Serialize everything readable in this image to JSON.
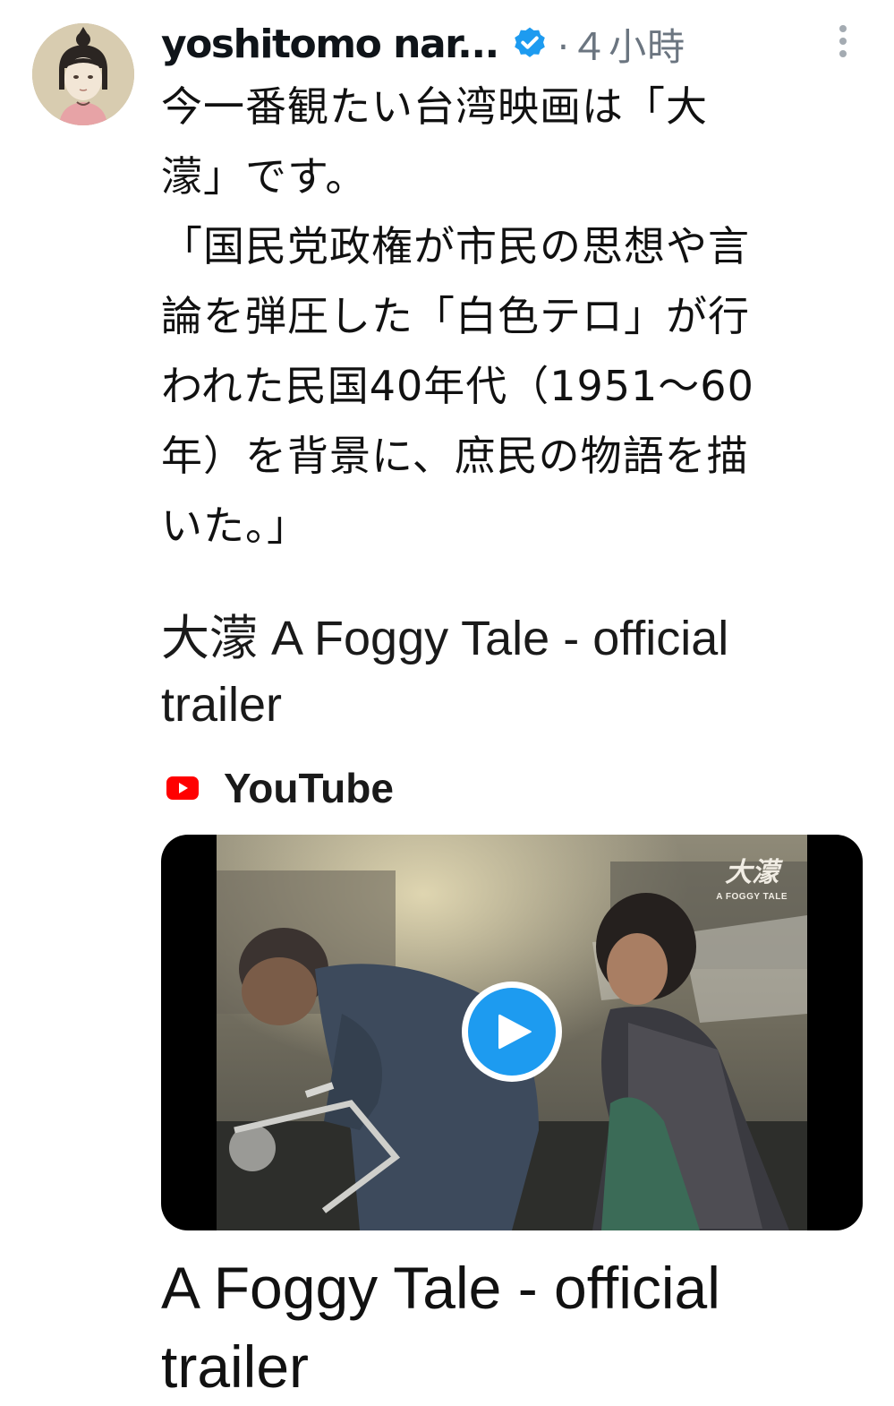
{
  "post": {
    "author_name": "yoshitomo nar...",
    "time": "·４小時",
    "text_lines": [
      "今一番観たい台湾映画は「大",
      "濛」です。",
      "「国民党政権が市民の思想や言",
      "論を弾圧した「白色テロ」が行",
      "われた民国40年代（1951〜60",
      "年）を背景に、庶民の物語を描",
      "いた。」"
    ]
  },
  "link_card": {
    "title_lines": [
      "大濛  A Foggy Tale - official",
      "trailer"
    ],
    "source": "YouTube",
    "thumbnail_logo_title": "大濛",
    "thumbnail_logo_sub": "A FOGGY TALE",
    "video_title_lines": [
      "A Foggy Tale - official",
      "trailer"
    ]
  },
  "icons": {
    "avatar": "avatar-illustrated-girl",
    "verified": "verified-badge-icon",
    "more": "more-vertical-icon",
    "youtube": "youtube-icon",
    "play": "play-icon"
  },
  "colors": {
    "verified_blue": "#1d9bf0",
    "youtube_red": "#ff0000",
    "meta_gray": "#6b7580"
  }
}
